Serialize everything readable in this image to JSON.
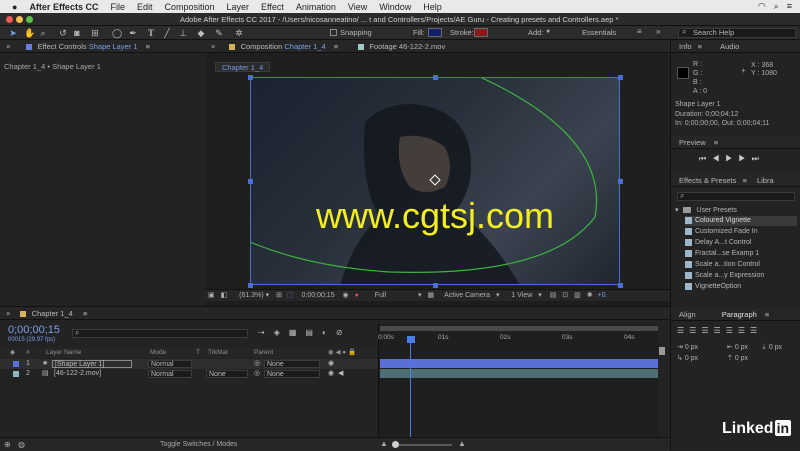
{
  "menubar": {
    "apple": "",
    "items": [
      "After Effects CC",
      "File",
      "Edit",
      "Composition",
      "Layer",
      "Effect",
      "Animation",
      "View",
      "Window",
      "Help"
    ]
  },
  "titlebar": {
    "text": "Adobe After Effects CC 2017 - /Users/nicosanneatino/ ... t and Controllers/Projects/AE Guru - Creating presets and Controllers.aep *"
  },
  "toolbar": {
    "snapping": "Snapping",
    "fill": "Fill:",
    "stroke": "Stroke:",
    "add": "Add:",
    "workspace": "Essentials",
    "search_placeholder": "Search Help"
  },
  "left_panel": {
    "tab": "Effect Controls",
    "tab_target": "Shape Layer 1",
    "breadcrumb": "Chapter 1_4 • Shape Layer 1"
  },
  "comp_panel": {
    "tab_label": "Composition",
    "tab_target": "Chapter 1_4",
    "footage_tab": "Footage 46-122-2.mov",
    "comp_chip": "Chapter 1_4"
  },
  "watermark": "www.cgtsj.com",
  "viewer_bar": {
    "zoom": "(61.3%)",
    "timecode": "0;00;00;15",
    "resolution": "Full",
    "camera": "Active Camera",
    "views": "1 View",
    "exposure": "+0."
  },
  "info_panel": {
    "tab_info": "Info",
    "tab_audio": "Audio",
    "r": "R :",
    "g": "G :",
    "b": "B :",
    "a": "A : 0",
    "x": "X : 368",
    "y": "Y : 1080",
    "layer": "Shape Layer 1",
    "duration": "Duration: 0;00;04;12",
    "inout": "In: 0;00;00;00, Out: 0;00;04;11"
  },
  "preview_panel": {
    "title": "Preview"
  },
  "effects_panel": {
    "tab": "Effects & Presets",
    "tab2": "Libra",
    "search_placeholder": "",
    "folder": "User Presets",
    "items": [
      "Coloured Vignette",
      "Customized Fade In",
      "Delay A...t Control",
      "Fractal...se Examp 1",
      "Scale a...tion Control",
      "Scale a...y Expression",
      "VignetteOption"
    ]
  },
  "align_panel": {
    "tab_align": "Align",
    "tab_paragraph": "Paragraph",
    "values": [
      "0 px",
      "0 px",
      "0 px",
      "0 px",
      "0 px"
    ]
  },
  "timeline": {
    "tab": "Chapter 1_4",
    "timecode": "0;00;00;15",
    "fps": "00015 (29.97 fps)",
    "search_placeholder": "",
    "columns": [
      "#",
      "Layer Name",
      "Mode",
      "T",
      "TrkMat",
      "Parent"
    ],
    "ruler": [
      "0:00s",
      "01s",
      "02s",
      "03s",
      "04s"
    ],
    "layers": [
      {
        "num": "1",
        "name": "[Shape Layer 1]",
        "mode": "Normal",
        "trkmat": "",
        "parent": "None",
        "color": "#5a6fd8"
      },
      {
        "num": "2",
        "name": "[46-122-2.mov]",
        "mode": "Normal",
        "trkmat": "None",
        "parent": "None",
        "color": "#8fb5c2"
      }
    ],
    "footer": "Toggle Switches / Modes"
  },
  "brand": {
    "text": "Linked",
    "in": "in"
  }
}
